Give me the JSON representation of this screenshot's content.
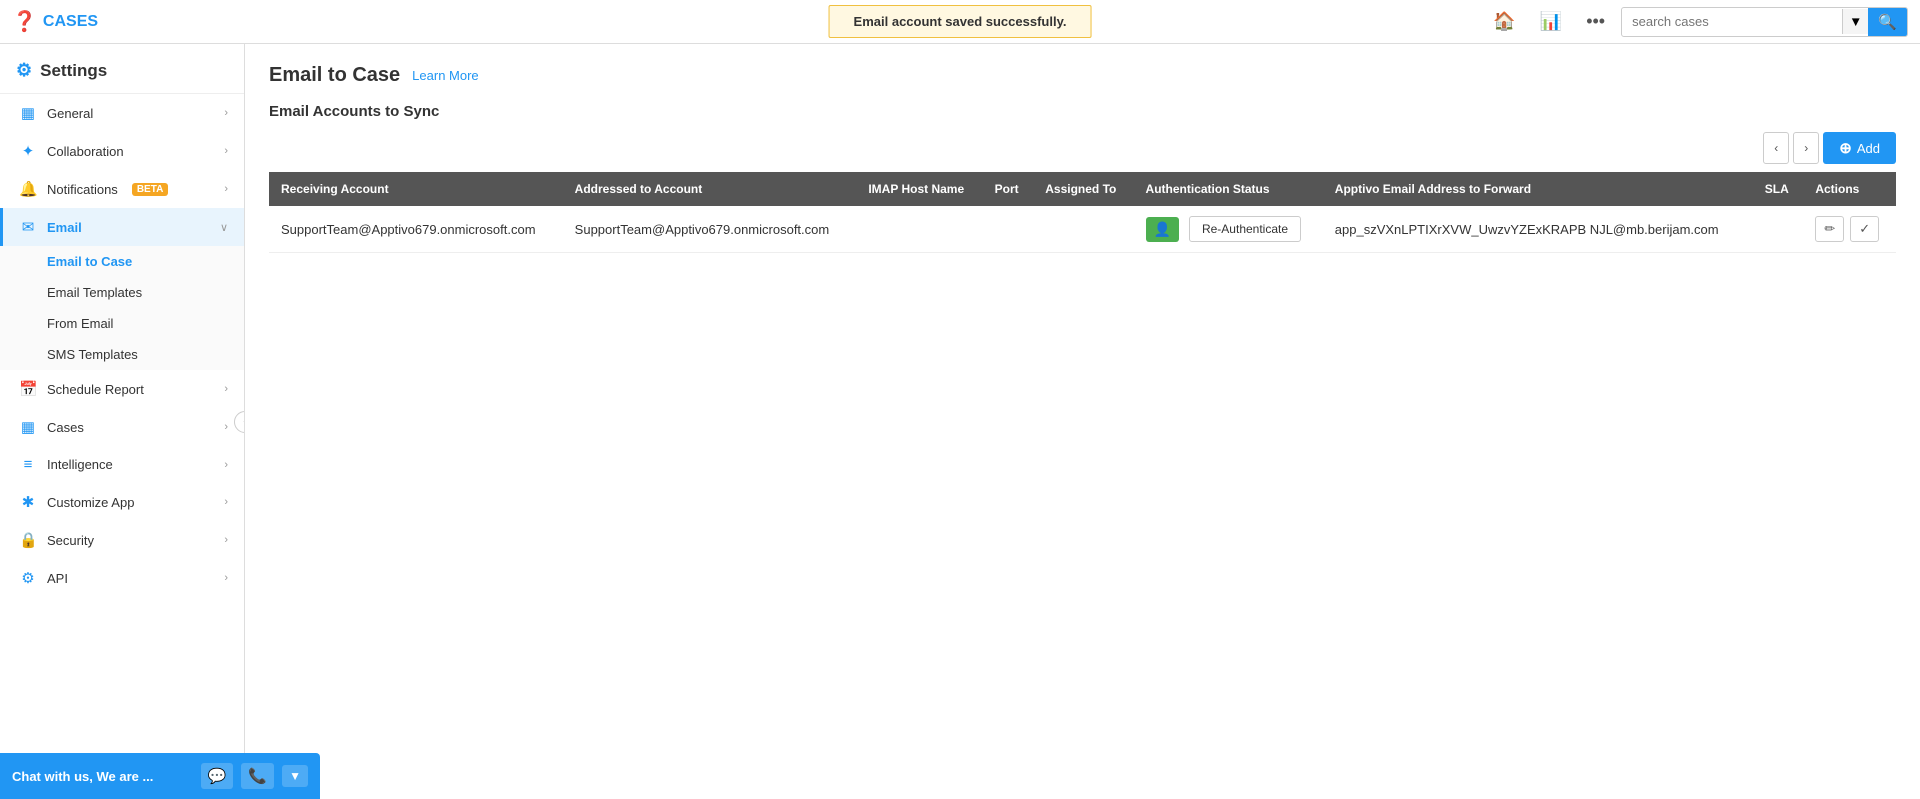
{
  "app": {
    "title": "CASES",
    "logo_icon": "❓"
  },
  "topbar": {
    "success_message": "Email account saved successfully.",
    "search_placeholder": "search cases",
    "home_icon": "⌂",
    "chart_icon": "📊",
    "more_icon": "•••",
    "search_go_icon": "🔍"
  },
  "sidebar": {
    "settings_label": "Settings",
    "items": [
      {
        "id": "general",
        "label": "General",
        "icon": "☰",
        "has_chevron": true,
        "active": false
      },
      {
        "id": "collaboration",
        "label": "Collaboration",
        "icon": "👥",
        "has_chevron": true,
        "active": false
      },
      {
        "id": "notifications",
        "label": "Notifications",
        "badge": "BETA",
        "icon": "🔔",
        "has_chevron": true,
        "active": false
      },
      {
        "id": "email",
        "label": "Email",
        "icon": "✉",
        "has_chevron": true,
        "active": true,
        "expanded": true
      },
      {
        "id": "schedule-report",
        "label": "Schedule Report",
        "icon": "📅",
        "has_chevron": true,
        "active": false
      },
      {
        "id": "cases",
        "label": "Cases",
        "icon": "📋",
        "has_chevron": true,
        "active": false
      },
      {
        "id": "intelligence",
        "label": "Intelligence",
        "icon": "≡",
        "has_chevron": true,
        "active": false
      },
      {
        "id": "customize-app",
        "label": "Customize App",
        "icon": "✱",
        "has_chevron": true,
        "active": false
      },
      {
        "id": "security",
        "label": "Security",
        "icon": "🔒",
        "has_chevron": true,
        "active": false
      },
      {
        "id": "api",
        "label": "API",
        "icon": "⚙",
        "has_chevron": true,
        "active": false
      }
    ],
    "email_subitems": [
      {
        "id": "email-to-case",
        "label": "Email to Case",
        "active": true
      },
      {
        "id": "email-templates",
        "label": "Email Templates",
        "active": false
      },
      {
        "id": "from-email",
        "label": "From Email",
        "active": false
      },
      {
        "id": "sms-templates",
        "label": "SMS Templates",
        "active": false
      }
    ]
  },
  "main": {
    "page_title": "Email to Case",
    "learn_more_label": "Learn More",
    "section_title": "Email Accounts to Sync",
    "add_button_label": "Add",
    "table": {
      "columns": [
        "Receiving Account",
        "Addressed to Account",
        "IMAP Host Name",
        "Port",
        "Assigned To",
        "Authentication Status",
        "Apptivo Email Address to Forward",
        "SLA",
        "Actions"
      ],
      "rows": [
        {
          "receiving_account": "SupportTeam@Apptivo679.onmicrosoft.com",
          "addressed_to_account": "SupportTeam@Apptivo679.onmicrosoft.com",
          "imap_host_name": "",
          "port": "",
          "assigned_to": "",
          "auth_status_icon": "👤",
          "re_authenticate_label": "Re-Authenticate",
          "apptivo_email": "app_szVXnLPTIXrXVW_UwzvYZExKRAPB NJL@mb.berijam.com",
          "sla": "",
          "actions": [
            "edit",
            "check"
          ]
        }
      ]
    }
  },
  "chat_widget": {
    "text": "Chat with us, We are ...",
    "chat_icon": "💬",
    "phone_icon": "📞",
    "dropdown_icon": "▼"
  }
}
